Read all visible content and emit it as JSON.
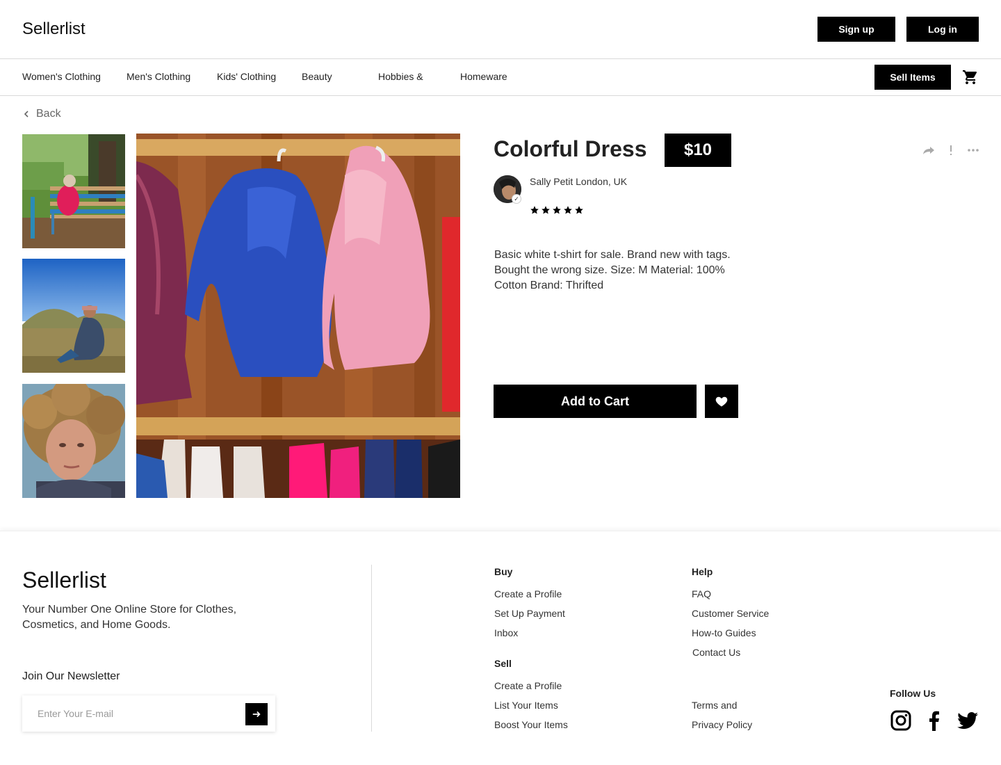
{
  "header": {
    "logo": "Sellerlist",
    "signup_label": "Sign up",
    "login_label": "Log in"
  },
  "categories": [
    "Women's Clothing",
    "Men's Clothing",
    "Kids' Clothing",
    "Beauty",
    "Hobbies &",
    "Homeware"
  ],
  "catbar": {
    "sell_label": "Sell Items",
    "cart_icon": "cart-icon"
  },
  "product": {
    "back_label": "Back",
    "title": "Colorful Dress",
    "price": "$10",
    "seller": "Sally Petit London, UK",
    "rating": 5,
    "description": "Basic white t-shirt for sale. Brand new with tags. Bought the wrong size. Size: M Material: 100% Cotton Brand: Thrifted",
    "add_to_cart_label": "Add to Cart",
    "icons": [
      "share-icon",
      "report-icon",
      "more-icon",
      "heart-icon"
    ]
  },
  "footer": {
    "logo": "Sellerlist",
    "tagline": "Your Number One Online Store for Clothes, Cosmetics, and Home Goods.",
    "newsletter_title": "Join Our Newsletter",
    "email_placeholder": "Enter Your E-mail",
    "buy": {
      "heading": "Buy",
      "links": [
        "Create a Profile",
        "Set Up Payment",
        "Inbox"
      ]
    },
    "sell": {
      "heading": "Sell",
      "links": [
        "Create a Profile",
        "List Your Items",
        "Boost Your Items"
      ]
    },
    "help": {
      "heading": "Help",
      "links": [
        "FAQ",
        "Customer Service",
        "How-to Guides",
        "Contact Us"
      ]
    },
    "legal": [
      "Terms and",
      "Privacy Policy"
    ],
    "follow_title": "Follow Us",
    "social_icons": [
      "instagram-icon",
      "facebook-icon",
      "twitter-icon"
    ]
  }
}
